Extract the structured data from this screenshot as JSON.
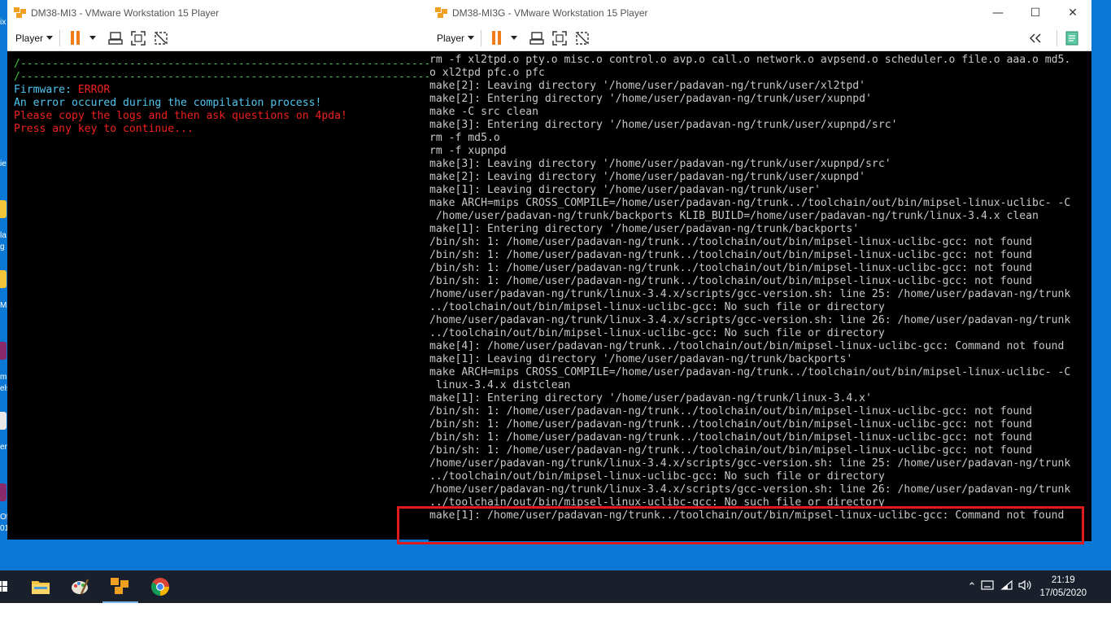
{
  "colors": {
    "desktop": "#0a78d4",
    "console_text": "#c8c8c8",
    "dash_green": "#3ec03e",
    "cyan": "#4fc6f0",
    "red": "#f02020",
    "pause_orange": "#f07c1b",
    "highlight": "#e01a1a",
    "taskbar": "#1a1f2c"
  },
  "left_window": {
    "title": "DM38-MI3 - VMware Workstation 15 Player",
    "player_menu": "Player",
    "icons": [
      "vmware-logo-icon",
      "pause-icon",
      "dropdown-caret-icon",
      "send-ctrl-alt-del-icon",
      "fullscreen-icon",
      "unity-icon"
    ],
    "console": {
      "dashes": "/----------------------------------------------------------------------",
      "firmware_label": "Firmware: ",
      "firmware_status": "ERROR",
      "line_compile": "An error occured during the compilation process!",
      "line_logs": "Please copy the logs and then ask questions on 4pda!",
      "line_press": "Press any key to continue..."
    }
  },
  "right_window": {
    "title": "DM38-MI3G - VMware Workstation 15 Player",
    "player_menu": "Player",
    "window_buttons": [
      "minimize",
      "maximize",
      "close"
    ],
    "icons": [
      "vmware-logo-icon",
      "pause-icon",
      "dropdown-caret-icon",
      "send-ctrl-alt-del-icon",
      "fullscreen-icon",
      "unity-icon",
      "collapse-icon",
      "message-log-icon"
    ],
    "console_lines": [
      "rm -f xl2tpd.o pty.o misc.o control.o avp.o call.o network.o avpsend.o scheduler.o file.o aaa.o md5.",
      "o xl2tpd pfc.o pfc",
      "make[2]: Leaving directory '/home/user/padavan-ng/trunk/user/xl2tpd'",
      "make[2]: Entering directory '/home/user/padavan-ng/trunk/user/xupnpd'",
      "make -C src clean",
      "make[3]: Entering directory '/home/user/padavan-ng/trunk/user/xupnpd/src'",
      "rm -f md5.o",
      "rm -f xupnpd",
      "make[3]: Leaving directory '/home/user/padavan-ng/trunk/user/xupnpd/src'",
      "make[2]: Leaving directory '/home/user/padavan-ng/trunk/user/xupnpd'",
      "make[1]: Leaving directory '/home/user/padavan-ng/trunk/user'",
      "make ARCH=mips CROSS_COMPILE=/home/user/padavan-ng/trunk../toolchain/out/bin/mipsel-linux-uclibc- -C",
      " /home/user/padavan-ng/trunk/backports KLIB_BUILD=/home/user/padavan-ng/trunk/linux-3.4.x clean",
      "make[1]: Entering directory '/home/user/padavan-ng/trunk/backports'",
      "/bin/sh: 1: /home/user/padavan-ng/trunk../toolchain/out/bin/mipsel-linux-uclibc-gcc: not found",
      "/bin/sh: 1: /home/user/padavan-ng/trunk../toolchain/out/bin/mipsel-linux-uclibc-gcc: not found",
      "/bin/sh: 1: /home/user/padavan-ng/trunk../toolchain/out/bin/mipsel-linux-uclibc-gcc: not found",
      "/bin/sh: 1: /home/user/padavan-ng/trunk../toolchain/out/bin/mipsel-linux-uclibc-gcc: not found",
      "/home/user/padavan-ng/trunk/linux-3.4.x/scripts/gcc-version.sh: line 25: /home/user/padavan-ng/trunk",
      "../toolchain/out/bin/mipsel-linux-uclibc-gcc: No such file or directory",
      "/home/user/padavan-ng/trunk/linux-3.4.x/scripts/gcc-version.sh: line 26: /home/user/padavan-ng/trunk",
      "../toolchain/out/bin/mipsel-linux-uclibc-gcc: No such file or directory",
      "make[4]: /home/user/padavan-ng/trunk../toolchain/out/bin/mipsel-linux-uclibc-gcc: Command not found",
      "make[1]: Leaving directory '/home/user/padavan-ng/trunk/backports'",
      "make ARCH=mips CROSS_COMPILE=/home/user/padavan-ng/trunk../toolchain/out/bin/mipsel-linux-uclibc- -C",
      " linux-3.4.x distclean",
      "make[1]: Entering directory '/home/user/padavan-ng/trunk/linux-3.4.x'",
      "/bin/sh: 1: /home/user/padavan-ng/trunk../toolchain/out/bin/mipsel-linux-uclibc-gcc: not found",
      "/bin/sh: 1: /home/user/padavan-ng/trunk../toolchain/out/bin/mipsel-linux-uclibc-gcc: not found",
      "/bin/sh: 1: /home/user/padavan-ng/trunk../toolchain/out/bin/mipsel-linux-uclibc-gcc: not found",
      "/bin/sh: 1: /home/user/padavan-ng/trunk../toolchain/out/bin/mipsel-linux-uclibc-gcc: not found",
      "/home/user/padavan-ng/trunk/linux-3.4.x/scripts/gcc-version.sh: line 25: /home/user/padavan-ng/trunk",
      "../toolchain/out/bin/mipsel-linux-uclibc-gcc: No such file or directory",
      "/home/user/padavan-ng/trunk/linux-3.4.x/scripts/gcc-version.sh: line 26: /home/user/padavan-ng/trunk",
      "../toolchain/out/bin/mipsel-linux-uclibc-gcc: No such file or directory",
      "make[1]: /home/user/padavan-ng/trunk../toolchain/out/bin/mipsel-linux-uclibc-gcc: Command not found"
    ]
  },
  "desktop_edge": {
    "fragments": [
      "ix",
      "ie",
      "la",
      "g",
      "Ma",
      "m",
      "els",
      "er",
      "Of",
      "01"
    ]
  },
  "taskbar": {
    "apps": [
      "start-icon",
      "file-explorer-icon",
      "paint-icon",
      "vmware-player-icon",
      "chrome-icon"
    ],
    "tray_icons": [
      "chevron-up-icon",
      "keyboard-language-icon",
      "wifi-icon",
      "volume-icon"
    ],
    "time": "21:19",
    "date": "17/05/2020"
  }
}
